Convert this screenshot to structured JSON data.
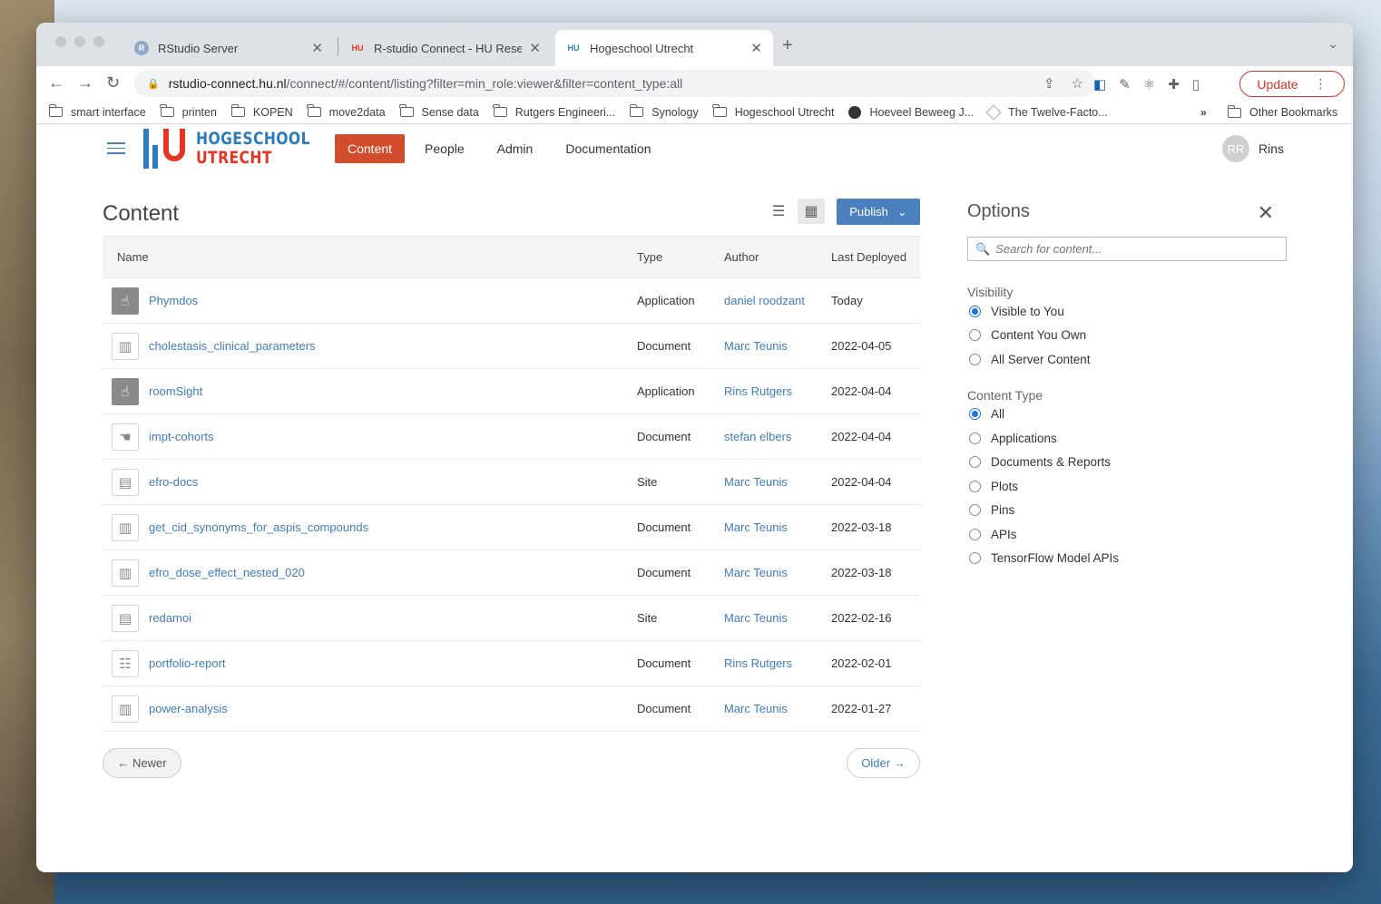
{
  "browser": {
    "tabs": [
      {
        "title": "RStudio Server",
        "favicon": "R"
      },
      {
        "title": "R-studio Connect - HU Resear",
        "favicon": "HU"
      },
      {
        "title": "Hogeschool Utrecht",
        "favicon": "HU",
        "active": true
      }
    ],
    "url_host": "rstudio-connect.hu.nl",
    "url_path": "/connect/#/content/listing?filter=min_role:viewer&filter=content_type:all",
    "update_label": "Update",
    "bookmarks": [
      "smart interface",
      "printen",
      "KOPEN",
      "move2data",
      "Sense data",
      "Rutgers Engineeri...",
      "Synology",
      "Hogeschool Utrecht",
      "Hoeveel Beweeg J...",
      "The Twelve-Facto..."
    ],
    "bookmarks_more": "»",
    "other_bookmarks": "Other Bookmarks"
  },
  "app": {
    "logo_line1": "HOGESCHOOL",
    "logo_line2": "UTRECHT",
    "nav": [
      "Content",
      "People",
      "Admin",
      "Documentation"
    ],
    "user_initials": "RR",
    "user_name": "Rins"
  },
  "content": {
    "title": "Content",
    "publish_label": "Publish",
    "columns": [
      "Name",
      "Type",
      "Author",
      "Last Deployed"
    ],
    "rows": [
      {
        "name": "Phymdos",
        "type": "Application",
        "author": "daniel roodzant",
        "date": "Today",
        "icon": "hand-pointer-icon"
      },
      {
        "name": "cholestasis_clinical_parameters",
        "type": "Document",
        "author": "Marc Teunis",
        "date": "2022-04-05",
        "icon": "document-chart-icon"
      },
      {
        "name": "roomSight",
        "type": "Application",
        "author": "Rins Rutgers",
        "date": "2022-04-04",
        "icon": "hand-pointer-icon"
      },
      {
        "name": "impt-cohorts",
        "type": "Document",
        "author": "stefan elbers",
        "date": "2022-04-04",
        "icon": "document-hand-icon"
      },
      {
        "name": "efro-docs",
        "type": "Site",
        "author": "Marc Teunis",
        "date": "2022-04-04",
        "icon": "site-icon"
      },
      {
        "name": "get_cid_synonyms_for_aspis_compounds",
        "type": "Document",
        "author": "Marc Teunis",
        "date": "2022-03-18",
        "icon": "document-chart-icon"
      },
      {
        "name": "efro_dose_effect_nested_020",
        "type": "Document",
        "author": "Marc Teunis",
        "date": "2022-03-18",
        "icon": "document-chart-icon"
      },
      {
        "name": "redamoi",
        "type": "Site",
        "author": "Marc Teunis",
        "date": "2022-02-16",
        "icon": "site-icon"
      },
      {
        "name": "portfolio-report",
        "type": "Document",
        "author": "Rins Rutgers",
        "date": "2022-02-01",
        "icon": "sliders-icon"
      },
      {
        "name": "power-analysis",
        "type": "Document",
        "author": "Marc Teunis",
        "date": "2022-01-27",
        "icon": "document-chart-icon"
      }
    ],
    "newer_label": "← Newer",
    "older_label": "Older →"
  },
  "options": {
    "title": "Options",
    "search_placeholder": "Search for content...",
    "visibility_label": "Visibility",
    "visibility": [
      {
        "label": "Visible to You",
        "checked": true
      },
      {
        "label": "Content You Own",
        "checked": false
      },
      {
        "label": "All Server Content",
        "checked": false
      }
    ],
    "content_type_label": "Content Type",
    "content_types": [
      {
        "label": "All",
        "checked": true
      },
      {
        "label": "Applications",
        "checked": false
      },
      {
        "label": "Documents & Reports",
        "checked": false
      },
      {
        "label": "Plots",
        "checked": false
      },
      {
        "label": "Pins",
        "checked": false
      },
      {
        "label": "APIs",
        "checked": false
      },
      {
        "label": "TensorFlow Model APIs",
        "checked": false
      }
    ]
  }
}
